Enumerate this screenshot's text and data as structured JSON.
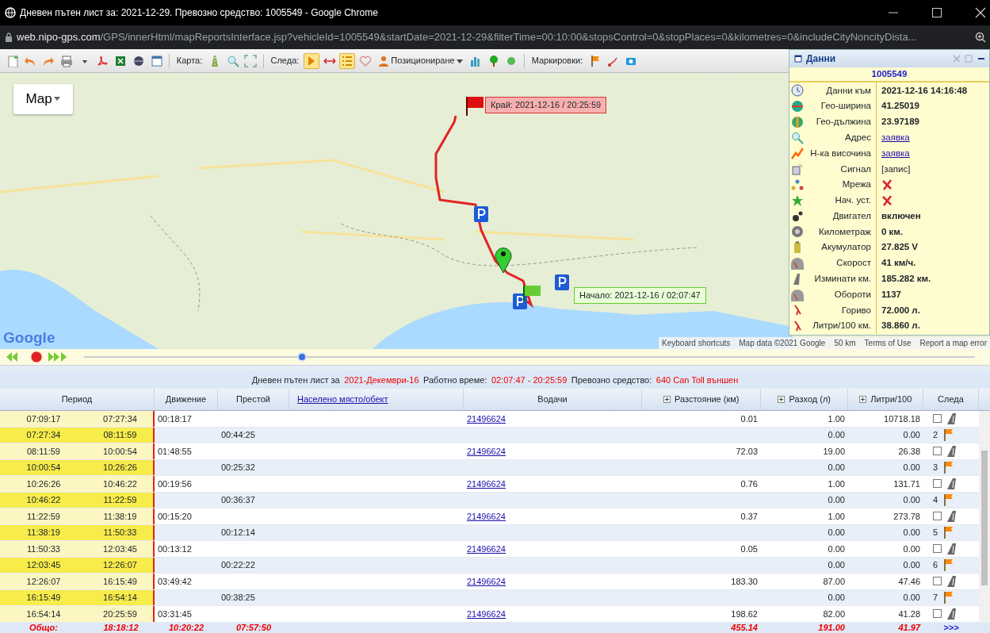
{
  "window": {
    "title": "Дневен пътен лист за: 2021-12-29. Превозно средство: 1005549 - Google Chrome",
    "url_host": "web.nipo-gps.com",
    "url_path": "/GPS/innerHtml/mapReportsInterface.jsp?vehicleId=1005549&startDate=2021-12-29&filterTime=00:10:00&stopsControl=0&stopPlaces=0&kilometres=0&includeCityNoncityDista..."
  },
  "toolbar": {
    "map_label": "Карта:",
    "track_label": "Следа:",
    "positioning": "Позициониране",
    "markers_label": "Маркировки:",
    "track_tools": [
      {
        "selected": true
      },
      {
        "selected": false
      },
      {
        "selected": true
      },
      {
        "selected": false
      }
    ]
  },
  "map": {
    "type_button": "Map",
    "end_label": "Край: 2021-12-16 / 20:25:59",
    "start_label": "Начало: 2021-12-16 / 02:07:47",
    "logo": "Google",
    "footer": [
      "Keyboard shortcuts",
      "Map data ©2021 Google",
      "50 km",
      "Terms of Use",
      "Report a map error"
    ]
  },
  "playback": {
    "level": 0.24
  },
  "data_panel": {
    "title": "Данни",
    "vehicle": "1005549",
    "rows": [
      {
        "label": "Данни към",
        "kind": "bold",
        "value": "2021-12-16 14:16:48"
      },
      {
        "label": "Гео-ширина",
        "kind": "bold",
        "value": "41.25019"
      },
      {
        "label": "Гео-дължина",
        "kind": "bold",
        "value": "23.97189"
      },
      {
        "label": "Адрес",
        "kind": "link",
        "value": "заявка"
      },
      {
        "label": "Н-ка височина",
        "kind": "link",
        "value": "заявка"
      },
      {
        "label": "Сигнал",
        "kind": "plain",
        "value": "[запис]"
      },
      {
        "label": "Мрежа",
        "kind": "cross"
      },
      {
        "label": "Нач. уст.",
        "kind": "cross"
      },
      {
        "label": "Двигател",
        "kind": "bold",
        "value": "включен"
      },
      {
        "label": "Километраж",
        "kind": "bold",
        "value": "0 км."
      },
      {
        "label": "Акумулатор",
        "kind": "bold",
        "value": "27.825 V"
      },
      {
        "label": "Скорост",
        "kind": "bold",
        "value": "41 км/ч."
      },
      {
        "label": "Изминати км.",
        "kind": "bold",
        "value": "185.282 км."
      },
      {
        "label": "Обороти",
        "kind": "bold",
        "value": "1137"
      },
      {
        "label": "Гориво",
        "kind": "bold",
        "value": "72.000 л."
      },
      {
        "label": "Литри/100 км.",
        "kind": "bold",
        "value": "38.860 л."
      }
    ]
  },
  "summary": [
    {
      "label": "Дневен пътен лист за",
      "value": "2021-Декември-16"
    },
    {
      "label": "Работно време:",
      "value": "02:07:47 - 20:25:59"
    },
    {
      "label": "Превозно средство:",
      "value": "640 Can Toll външен"
    }
  ],
  "table": {
    "columns": [
      "Период",
      "Движение",
      "Престой",
      "Населено място/обект",
      "Водачи",
      "Разстояние (км)",
      "Разход (л)",
      "Литри/100",
      "Следа"
    ],
    "rows": [
      {
        "kind": "move",
        "start": "07:09:17",
        "end": "07:27:34",
        "time": "00:18:17",
        "driver": "21496624",
        "distance": "0.01",
        "fuel": "1.00",
        "per100": "10718.18",
        "checked": false
      },
      {
        "kind": "stop",
        "start": "07:27:34",
        "end": "08:11:59",
        "time": "00:44:25",
        "fuel": "0.00",
        "per100": "0.00",
        "number": "2"
      },
      {
        "kind": "move",
        "start": "08:11:59",
        "end": "10:00:54",
        "time": "01:48:55",
        "driver": "21496624",
        "distance": "72.03",
        "fuel": "19.00",
        "per100": "26.38",
        "checked": false
      },
      {
        "kind": "stop",
        "start": "10:00:54",
        "end": "10:26:26",
        "time": "00:25:32",
        "fuel": "0.00",
        "per100": "0.00",
        "number": "3"
      },
      {
        "kind": "move",
        "start": "10:26:26",
        "end": "10:46:22",
        "time": "00:19:56",
        "driver": "21496624",
        "distance": "0.76",
        "fuel": "1.00",
        "per100": "131.71",
        "checked": false
      },
      {
        "kind": "stop",
        "start": "10:46:22",
        "end": "11:22:59",
        "time": "00:36:37",
        "fuel": "0.00",
        "per100": "0.00",
        "number": "4"
      },
      {
        "kind": "move",
        "start": "11:22:59",
        "end": "11:38:19",
        "time": "00:15:20",
        "driver": "21496624",
        "distance": "0.37",
        "fuel": "1.00",
        "per100": "273.78",
        "checked": false
      },
      {
        "kind": "stop",
        "start": "11:38:19",
        "end": "11:50:33",
        "time": "00:12:14",
        "fuel": "0.00",
        "per100": "0.00",
        "number": "5"
      },
      {
        "kind": "move",
        "start": "11:50:33",
        "end": "12:03:45",
        "time": "00:13:12",
        "driver": "21496624",
        "distance": "0.05",
        "fuel": "0.00",
        "per100": "0.00",
        "checked": false
      },
      {
        "kind": "stop",
        "start": "12:03:45",
        "end": "12:26:07",
        "time": "00:22:22",
        "fuel": "0.00",
        "per100": "0.00",
        "number": "6"
      },
      {
        "kind": "move",
        "start": "12:26:07",
        "end": "16:15:49",
        "time": "03:49:42",
        "driver": "21496624",
        "distance": "183.30",
        "fuel": "87.00",
        "per100": "47.46",
        "checked": false
      },
      {
        "kind": "stop",
        "start": "16:15:49",
        "end": "16:54:14",
        "time": "00:38:25",
        "fuel": "0.00",
        "per100": "0.00",
        "number": "7"
      },
      {
        "kind": "move",
        "start": "16:54:14",
        "end": "20:25:59",
        "time": "03:31:45",
        "driver": "21496624",
        "distance": "198.62",
        "fuel": "82.00",
        "per100": "41.28",
        "checked": false
      }
    ],
    "totals": {
      "label": "Общо:",
      "period": "18:18:12",
      "movement": "10:20:22",
      "stop": "07:57:50",
      "distance": "455.14",
      "fuel": "191.00",
      "per100": "41.97",
      "more": ">>>"
    }
  }
}
